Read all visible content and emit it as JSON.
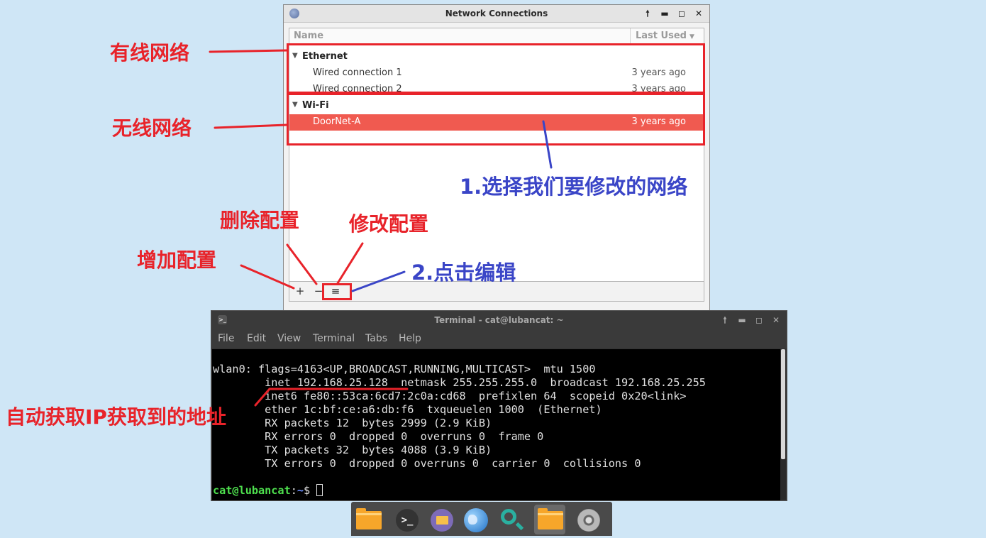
{
  "network_window": {
    "title": "Network Connections",
    "columns": {
      "name": "Name",
      "last_used": "Last Used"
    },
    "groups": [
      {
        "label": "Ethernet",
        "connections": [
          {
            "name": "Wired connection 1",
            "last_used": "3 years ago"
          },
          {
            "name": "Wired connection 2",
            "last_used": "3 years ago"
          }
        ]
      },
      {
        "label": "Wi-Fi",
        "connections": [
          {
            "name": "DoorNet-A",
            "last_used": "3 years ago",
            "selected": true
          }
        ]
      }
    ],
    "toolbar": {
      "add": "+",
      "remove": "−",
      "edit": "≡"
    }
  },
  "terminal": {
    "title": "Terminal - cat@lubancat: ~",
    "menu": [
      "File",
      "Edit",
      "View",
      "Terminal",
      "Tabs",
      "Help"
    ],
    "lines": [
      "wlan0: flags=4163<UP,BROADCAST,RUNNING,MULTICAST>  mtu 1500",
      "        inet 192.168.25.128  netmask 255.255.255.0  broadcast 192.168.25.255",
      "        inet6 fe80::53ca:6cd7:2c0a:cd68  prefixlen 64  scopeid 0x20<link>",
      "        ether 1c:bf:ce:a6:db:f6  txqueuelen 1000  (Ethernet)",
      "        RX packets 12  bytes 2999 (2.9 KiB)",
      "        RX errors 0  dropped 0  overruns 0  frame 0",
      "        TX packets 32  bytes 4088 (3.9 KiB)",
      "        TX errors 0  dropped 0 overruns 0  carrier 0  collisions 0"
    ],
    "prompt": {
      "user": "cat@lubancat",
      "sep": ":",
      "path": "~",
      "symbol": "$ "
    }
  },
  "annotations": {
    "wired": "有线网络",
    "wireless": "无线网络",
    "step1": "1.选择我们要修改的网络",
    "delete": "删除配置",
    "modify": "修改配置",
    "add": "增加配置",
    "step2": "2.点击编辑",
    "auto_ip": "自动获取IP获取到的地址"
  },
  "colors": {
    "annotation_red": "#e8232a",
    "annotation_blue": "#3a45c7",
    "selection": "#f05a50",
    "prompt_green": "#4ee04e",
    "prompt_blue": "#6b8cff"
  },
  "dock": [
    "folder-icon",
    "terminal-icon",
    "file-manager-icon",
    "web-browser-icon",
    "search-icon",
    "folder-icon",
    "disk-icon"
  ]
}
